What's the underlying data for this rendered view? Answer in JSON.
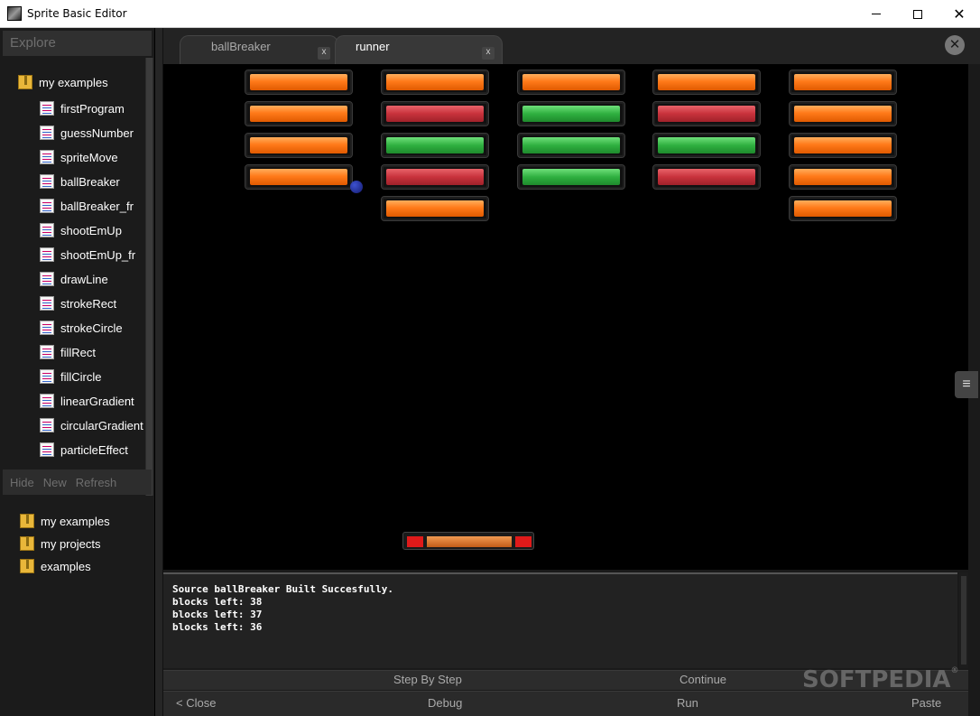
{
  "window": {
    "title": "Sprite Basic Editor",
    "minimize": "",
    "maximize": "",
    "close": "✕"
  },
  "sidebar": {
    "header": "Explore",
    "tree_root": "my examples",
    "tree_items": [
      "firstProgram",
      "guessNumber",
      "spriteMove",
      "ballBreaker",
      "ballBreaker_fr",
      "shootEmUp",
      "shootEmUp_fr",
      "drawLine",
      "strokeRect",
      "strokeCircle",
      "fillRect",
      "fillCircle",
      "linearGradient",
      "circularGradient",
      "particleEffect"
    ],
    "actions": {
      "hide": "Hide",
      "new": "New",
      "refresh": "Refresh"
    },
    "roots": [
      "my examples",
      "my projects",
      "examples"
    ]
  },
  "tabs": [
    {
      "label": "ballBreaker",
      "close": "x",
      "active": false
    },
    {
      "label": "runner",
      "close": "x",
      "active": true
    }
  ],
  "close_all": "✕",
  "game": {
    "brick_columns": [
      [
        "orange",
        "orange",
        "orange",
        "orange"
      ],
      [
        "orange",
        "red",
        "green",
        "red",
        "orange"
      ],
      [
        "orange",
        "green",
        "green",
        "green"
      ],
      [
        "orange",
        "red",
        "green",
        "red"
      ],
      [
        "orange",
        "orange",
        "orange",
        "orange",
        "orange"
      ]
    ],
    "colors": {
      "orange": "#ff7a1a",
      "red": "#c8323c",
      "green": "#2fb040",
      "ball": "#2a3ab0",
      "paddle_end": "#e01a1a"
    }
  },
  "menu_handle": "≡",
  "console": {
    "lines": [
      "Source ballBreaker Built Succesfully.",
      "blocks left: 38",
      "blocks left: 37",
      "blocks left: 36"
    ]
  },
  "toolbar": {
    "step_by_step": "Step By Step",
    "continue": "Continue",
    "close": "< Close",
    "debug": "Debug",
    "run": "Run",
    "paste": "Paste"
  },
  "watermark": {
    "text": "SOFTPEDIA",
    "mark": "®"
  }
}
